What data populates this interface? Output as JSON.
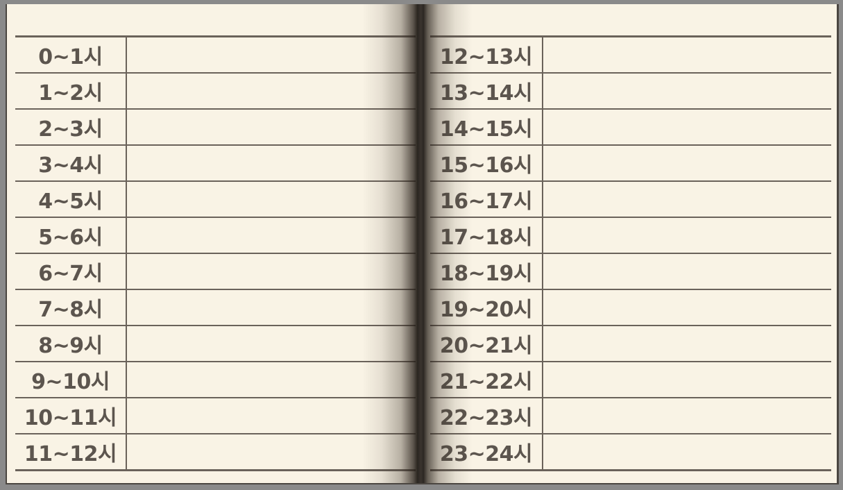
{
  "left_page": {
    "hours": [
      "0~1시",
      "1~2시",
      "2~3시",
      "3~4시",
      "4~5시",
      "5~6시",
      "6~7시",
      "7~8시",
      "8~9시",
      "9~10시",
      "10~11시",
      "11~12시"
    ]
  },
  "right_page": {
    "hours": [
      "12~13시",
      "13~14시",
      "14~15시",
      "15~16시",
      "16~17시",
      "17~18시",
      "18~19시",
      "19~20시",
      "20~21시",
      "21~22시",
      "22~23시",
      "23~24시"
    ]
  },
  "colors": {
    "paper": "#f9f3e5",
    "ink": "#5c554e",
    "rule": "#6a625a",
    "spine": "#2b2622"
  }
}
